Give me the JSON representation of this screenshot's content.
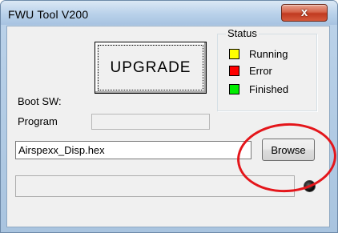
{
  "window": {
    "title": "FWU Tool V200",
    "close_glyph": "x"
  },
  "main": {
    "upgrade_label": "UPGRADE",
    "boot_sw_label": "Boot SW:",
    "program_label": "Program",
    "file_value": "Airspexx_Disp.hex",
    "browse_label": "Browse"
  },
  "status": {
    "legend": "Status",
    "items": [
      {
        "label": "Running",
        "color": "#ffff00"
      },
      {
        "label": "Error",
        "color": "#ff0000"
      },
      {
        "label": "Finished",
        "color": "#00ee00"
      }
    ]
  },
  "indicator": {
    "icon": "status-led-icon",
    "color": "#111111"
  },
  "annotation": {
    "color": "#e4161b"
  }
}
